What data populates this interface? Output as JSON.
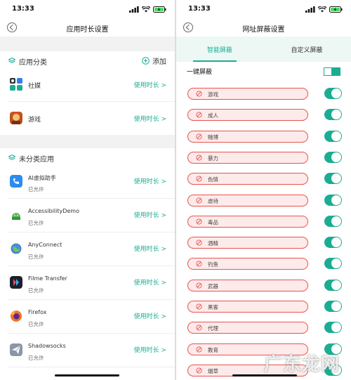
{
  "colors": {
    "accent": "#1aad93",
    "pill_border": "#e8544f",
    "pill_fill": "#fdeaea"
  },
  "left": {
    "status_time": "13:33",
    "title": "应用时长设置",
    "categories": {
      "title": "应用分类",
      "add_label": "添加",
      "items": [
        {
          "name": "社媒",
          "usage": "使用时长 >",
          "icon": "social-folder-icon"
        },
        {
          "name": "游戏",
          "usage": "使用时长 >",
          "icon": "game-avatar-icon"
        }
      ]
    },
    "uncategorized": {
      "title": "未分类应用",
      "items": [
        {
          "name": "AI虚拟助手",
          "status": "已允许",
          "usage": "使用时长 >",
          "icon": "ai-assistant-icon"
        },
        {
          "name": "AccessibilityDemo",
          "status": "已允许",
          "usage": "使用时长 >",
          "icon": "android-icon"
        },
        {
          "name": "AnyConnect",
          "status": "已允许",
          "usage": "使用时长 >",
          "icon": "globe-icon"
        },
        {
          "name": "Filme Transfer",
          "status": "已允许",
          "usage": "使用时长 >",
          "icon": "filme-icon"
        },
        {
          "name": "Firefox",
          "status": "已允许",
          "usage": "使用时长 >",
          "icon": "firefox-icon"
        },
        {
          "name": "Shadowsocks",
          "status": "已允许",
          "usage": "使用时长 >",
          "icon": "paper-plane-icon"
        }
      ]
    }
  },
  "right": {
    "status_time": "13:33",
    "title": "网址屏蔽设置",
    "tabs": [
      {
        "label": "智能屏蔽"
      },
      {
        "label": "自定义屏蔽"
      }
    ],
    "one_key_label": "一键屏蔽",
    "categories": [
      {
        "label": "游戏"
      },
      {
        "label": "成人"
      },
      {
        "label": "赌博"
      },
      {
        "label": "暴力"
      },
      {
        "label": "色情"
      },
      {
        "label": "虐待"
      },
      {
        "label": "毒品"
      },
      {
        "label": "酒精"
      },
      {
        "label": "钓鱼"
      },
      {
        "label": "武器"
      },
      {
        "label": "黑客"
      },
      {
        "label": "代理"
      },
      {
        "label": "教育"
      },
      {
        "label": "烟草"
      }
    ]
  },
  "watermark": "广东龙网"
}
